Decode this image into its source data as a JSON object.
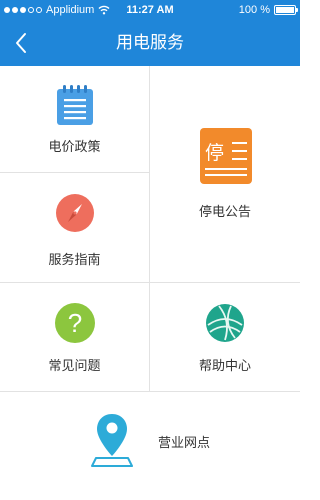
{
  "status_bar": {
    "carrier": "Applidium",
    "time": "11:27 AM",
    "battery": "100 %",
    "battery_level": 1.0
  },
  "nav": {
    "title": "用电服务",
    "back_icon": "chevron-left-icon"
  },
  "colors": {
    "nav_blue": "#1f86d9",
    "price_blue": "#4a9fe5",
    "outage_orange": "#f28a2b",
    "guide_red": "#ee6e5d",
    "faq_green": "#8cc63e",
    "help_teal": "#1fa58c",
    "outlet_blue": "#2dabd8"
  },
  "menu": {
    "price_policy": {
      "label": "电价政策",
      "icon": "document-list-icon"
    },
    "outage_notice": {
      "label": "停电公告",
      "icon": "notice-board-icon",
      "icon_text": "停"
    },
    "service_guide": {
      "label": "服务指南",
      "icon": "compass-icon"
    },
    "faq": {
      "label": "常见问题",
      "icon": "question-icon",
      "icon_text": "?"
    },
    "help_center": {
      "label": "帮助中心",
      "icon": "globe-icon"
    },
    "service_outlets": {
      "label": "营业网点",
      "icon": "map-pin-icon"
    }
  }
}
